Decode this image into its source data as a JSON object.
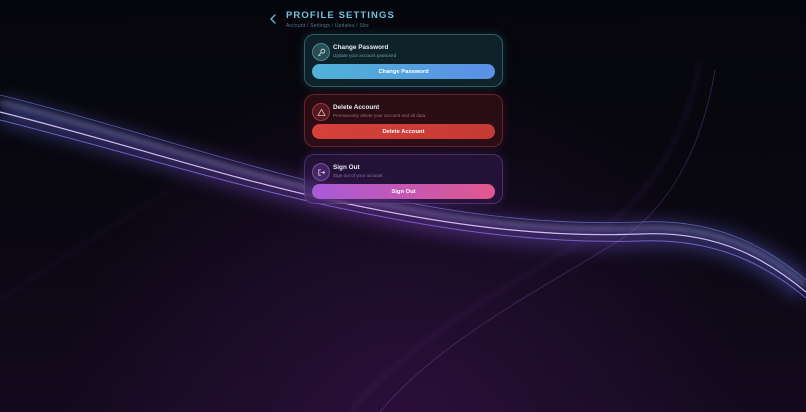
{
  "header": {
    "back_icon": "chevron-left-icon",
    "title": "PROFILE SETTINGS",
    "breadcrumb": "Account / Settings / Updates / Site"
  },
  "cards": {
    "password": {
      "icon": "key-icon",
      "title": "Change Password",
      "subtitle": "Update your account password",
      "button_label": "Change Password",
      "accent": "#4fb3d6"
    },
    "delete": {
      "icon": "warning-triangle-icon",
      "title": "Delete Account",
      "subtitle": "Permanently delete your account and all data",
      "button_label": "Delete Account",
      "accent": "#d6403a"
    },
    "signout": {
      "icon": "sign-out-icon",
      "title": "Sign Out",
      "subtitle": "Sign out of your account",
      "button_label": "Sign Out",
      "accent": "#c95aba"
    }
  },
  "colors": {
    "background": "#07060d",
    "title_cyan": "#6cc6df",
    "wave_blue": "#6a7dff",
    "wave_purple": "#a550e6"
  }
}
